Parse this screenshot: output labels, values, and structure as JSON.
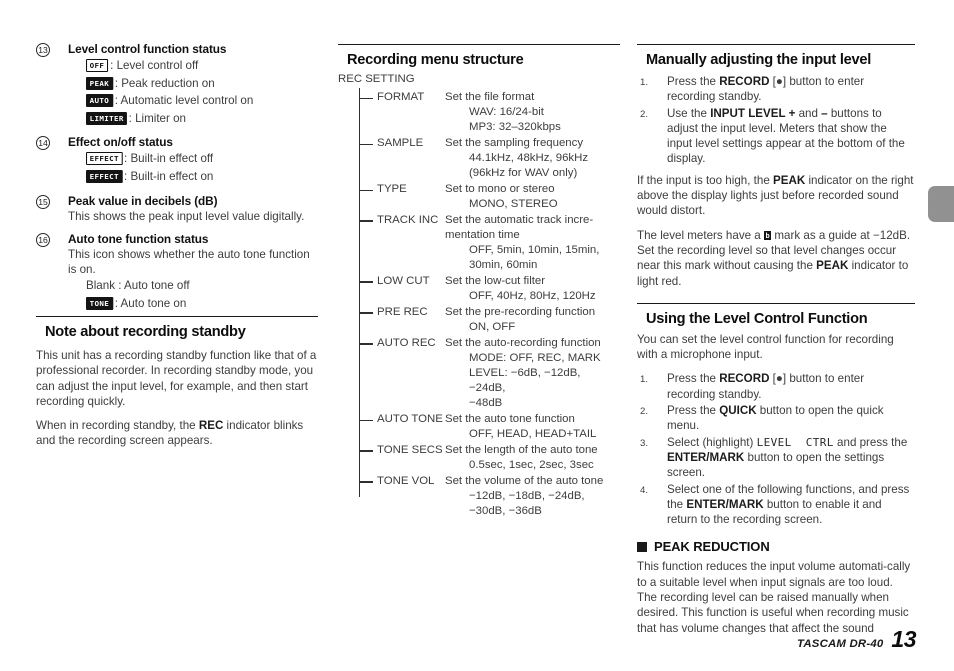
{
  "footer": {
    "brand": "TASCAM DR-40",
    "page": "13"
  },
  "column1": {
    "specs": [
      {
        "num": "13",
        "title": "Level control function status",
        "sub": [
          {
            "badge": "OFF",
            "badge_style": "outline",
            "text": ": Level control off"
          },
          {
            "badge": "PEAK",
            "badge_style": "inverted",
            "text": ": Peak reduction on"
          },
          {
            "badge": "AUTO",
            "badge_style": "inverted",
            "text": ": Automatic level control on"
          },
          {
            "badge": "LIMITER",
            "badge_style": "inverted",
            "text": ": Limiter on"
          }
        ]
      },
      {
        "num": "14",
        "title": "Effect on/off status",
        "sub": [
          {
            "badge": "EFFECT",
            "badge_style": "outline",
            "text": ": Built-in effect off"
          },
          {
            "badge": "EFFECT",
            "badge_style": "inverted",
            "text": ": Built-in effect on"
          }
        ]
      },
      {
        "num": "15",
        "title": "Peak value in decibels (dB)",
        "desc": "This shows the peak input level value digitally."
      },
      {
        "num": "16",
        "title": "Auto tone function status",
        "desc": "This icon shows whether the auto tone function is on.",
        "sub": [
          {
            "badge": "",
            "badge_style": "none",
            "text": "Blank : Auto tone off"
          },
          {
            "badge": "TONE",
            "badge_style": "inverted",
            "text": ": Auto tone on"
          }
        ]
      }
    ],
    "note": {
      "heading": "Note about recording standby",
      "paragraphs": [
        "This unit has a recording standby function like that of a professional recorder. In recording standby mode, you can adjust the input level, for example, and then start recording quickly.",
        "When in recording standby, the REC indicator blinks and the recording screen appears."
      ],
      "bold_terms": [
        "REC"
      ]
    }
  },
  "column2": {
    "heading": "Recording menu structure",
    "root": "REC SETTING",
    "items": [
      {
        "name": "FORMAT",
        "desc": "Set the file format",
        "values": [
          "WAV: 16/24-bit",
          "MP3: 32–320kbps"
        ],
        "thick": false
      },
      {
        "name": "SAMPLE",
        "desc": "Set the sampling frequency",
        "values": [
          "44.1kHz, 48kHz, 96kHz",
          "(96kHz for WAV only)"
        ],
        "thick": false
      },
      {
        "name": "TYPE",
        "desc": "Set to mono or stereo",
        "values": [
          "MONO, STEREO"
        ],
        "thick": false
      },
      {
        "name": "TRACK INC",
        "desc": "Set the automatic track incre-mentation time",
        "values": [
          "OFF, 5min, 10min, 15min,",
          "30min, 60min"
        ],
        "thick": true
      },
      {
        "name": "LOW CUT",
        "desc": "Set the low-cut filter",
        "values": [
          "OFF, 40Hz, 80Hz, 120Hz"
        ],
        "thick": true
      },
      {
        "name": "PRE REC",
        "desc": "Set the pre-recording function",
        "values": [
          "ON, OFF"
        ],
        "thick": true
      },
      {
        "name": "AUTO REC",
        "desc": "Set the auto-recording function",
        "values": [
          "MODE: OFF, REC, MARK",
          "LEVEL: −6dB, −12dB, −24dB,",
          "−48dB"
        ],
        "thick": true
      },
      {
        "name": "AUTO TONE",
        "desc": "Set the auto tone function",
        "values": [
          "OFF, HEAD, HEAD+TAIL"
        ],
        "thick": false
      },
      {
        "name": "TONE SECS",
        "desc": "Set the length of the auto tone",
        "values": [
          "0.5sec, 1sec, 2sec, 3sec"
        ],
        "thick": true
      },
      {
        "name": "TONE VOL",
        "desc": "Set the volume of the auto tone",
        "values": [
          "−12dB, −18dB, −24dB,",
          "−30dB, −36dB"
        ],
        "thick": true
      }
    ]
  },
  "column3": {
    "section1": {
      "heading": "Manually adjusting the input level",
      "steps": [
        {
          "num": "1.",
          "html": "Press the <b>RECORD</b> [●] button to enter recording standby."
        },
        {
          "num": "2.",
          "html": "Use the <b>INPUT LEVEL +</b> and <b>–</b> buttons to adjust the input level. Meters that show the input level settings appear at the bottom of the display."
        }
      ],
      "paragraphs": [
        "If the input is too high, the PEAK indicator on the right above the display lights just before recorded sound would distort.",
        "The level meters have a ♭ mark as a guide at −12dB. Set the recording level so that level changes occur near this mark without causing the PEAK indicator to light red."
      ]
    },
    "section2": {
      "heading": "Using the Level Control Function",
      "intro": "You can set the level control function for recording with a microphone input.",
      "steps": [
        {
          "num": "1.",
          "html": "Press the <b>RECORD</b> [●] button to enter recording standby."
        },
        {
          "num": "2.",
          "html": "Press the <b>QUICK</b> button to open the quick menu."
        },
        {
          "num": "3.",
          "html": "Select (highlight) <span class=\"mono-lcd\">LEVEL&nbsp;&nbsp;CTRL</span> and press the <b>ENTER/MARK</b> button to open the settings screen."
        },
        {
          "num": "4.",
          "html": "Select one of the following functions, and press the <b>ENTER/MARK</b> button to enable it and return to the recording screen."
        }
      ],
      "subheading": "PEAK REDUCTION",
      "subparagraph": "This function reduces the input volume automati-cally to a suitable level when input signals are too loud. The recording level can be raised manually when desired. This function is useful when recording music that has volume changes that affect the sound"
    }
  }
}
